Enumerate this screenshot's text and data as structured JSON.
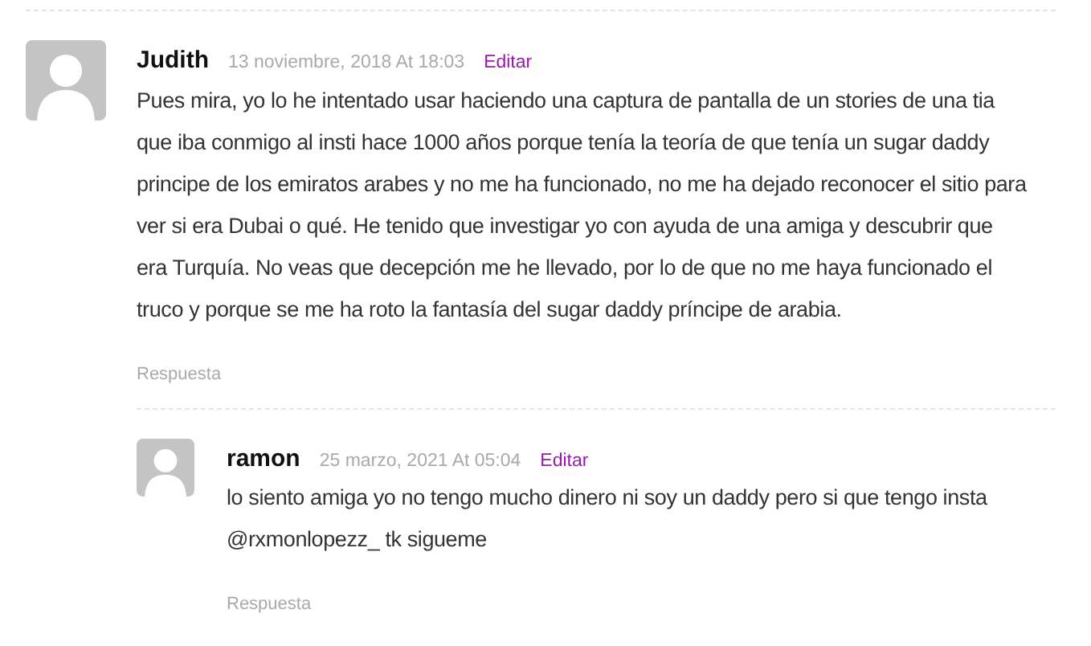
{
  "comments": [
    {
      "author": "Judith",
      "date": "13 noviembre, 2018 At 18:03",
      "edit": "Editar",
      "body": "Pues mira, yo lo he intentado usar haciendo una captura de pantalla de un stories de una tia que iba conmigo al insti hace 1000 años porque tenía la teoría de que tenía un sugar daddy principe de los emiratos arabes y no me ha funcionado, no me ha dejado reconocer el sitio para ver si era Dubai o qué. He tenido que investigar yo con ayuda de una amiga y descubrir que era Turquía. No veas que decepción me he llevado, por lo de que no me haya funcionado el truco y porque se me ha roto la fantasía del sugar daddy príncipe de arabia.",
      "reply": "Respuesta",
      "children": [
        {
          "author": "ramon",
          "date": "25 marzo, 2021 At 05:04",
          "edit": "Editar",
          "body": "lo siento amiga yo no tengo mucho dinero ni soy un daddy pero si que tengo insta @rxmonlopezz_ tk sigueme",
          "reply": "Respuesta"
        }
      ]
    }
  ]
}
